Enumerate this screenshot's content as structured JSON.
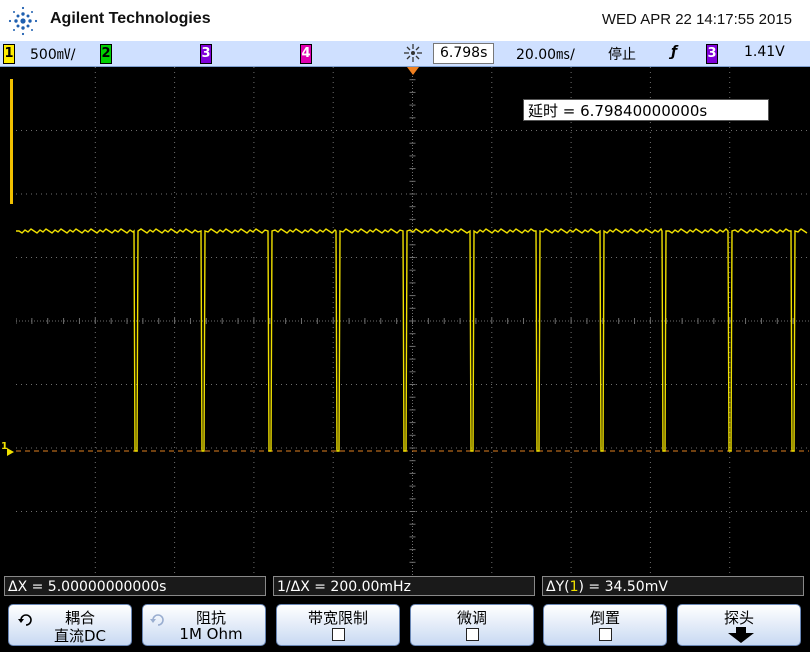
{
  "header": {
    "brand": "Agilent Technologies",
    "datetime": "WED APR 22 14:17:55 2015"
  },
  "status": {
    "ch1_label": "1",
    "ch1_scale": "500㎷/",
    "ch2_label": "2",
    "ch3_label": "3",
    "ch4_label": "4",
    "timebase_delay": "6.798s",
    "timebase_scale": "20.00㎳/",
    "run_state": "停止",
    "trigger_slope": "ƒ",
    "trigger_source": "3",
    "trigger_level": "1.41V"
  },
  "screen": {
    "delay_readout": "延时 = 6.79840000000s",
    "ch1_marker": "1"
  },
  "measurements": {
    "delta_x": "ΔX = 5.00000000000s",
    "inv_delta_x": "1/ΔX = 200.00mHz",
    "delta_y_prefix": "ΔY(",
    "delta_y_channel": "1",
    "delta_y_suffix": ") = 34.50mV"
  },
  "softkeys": {
    "coupling_label": "耦合",
    "coupling_value": "直流DC",
    "impedance_label": "阻抗",
    "impedance_value": "1M Ohm",
    "bw_limit_label": "带宽限制",
    "fine_label": "微调",
    "invert_label": "倒置",
    "probe_label": "探头"
  },
  "colors": {
    "trace": "#f0e000",
    "grid": "#6e6e6e",
    "ground_line": "#e08020"
  }
}
